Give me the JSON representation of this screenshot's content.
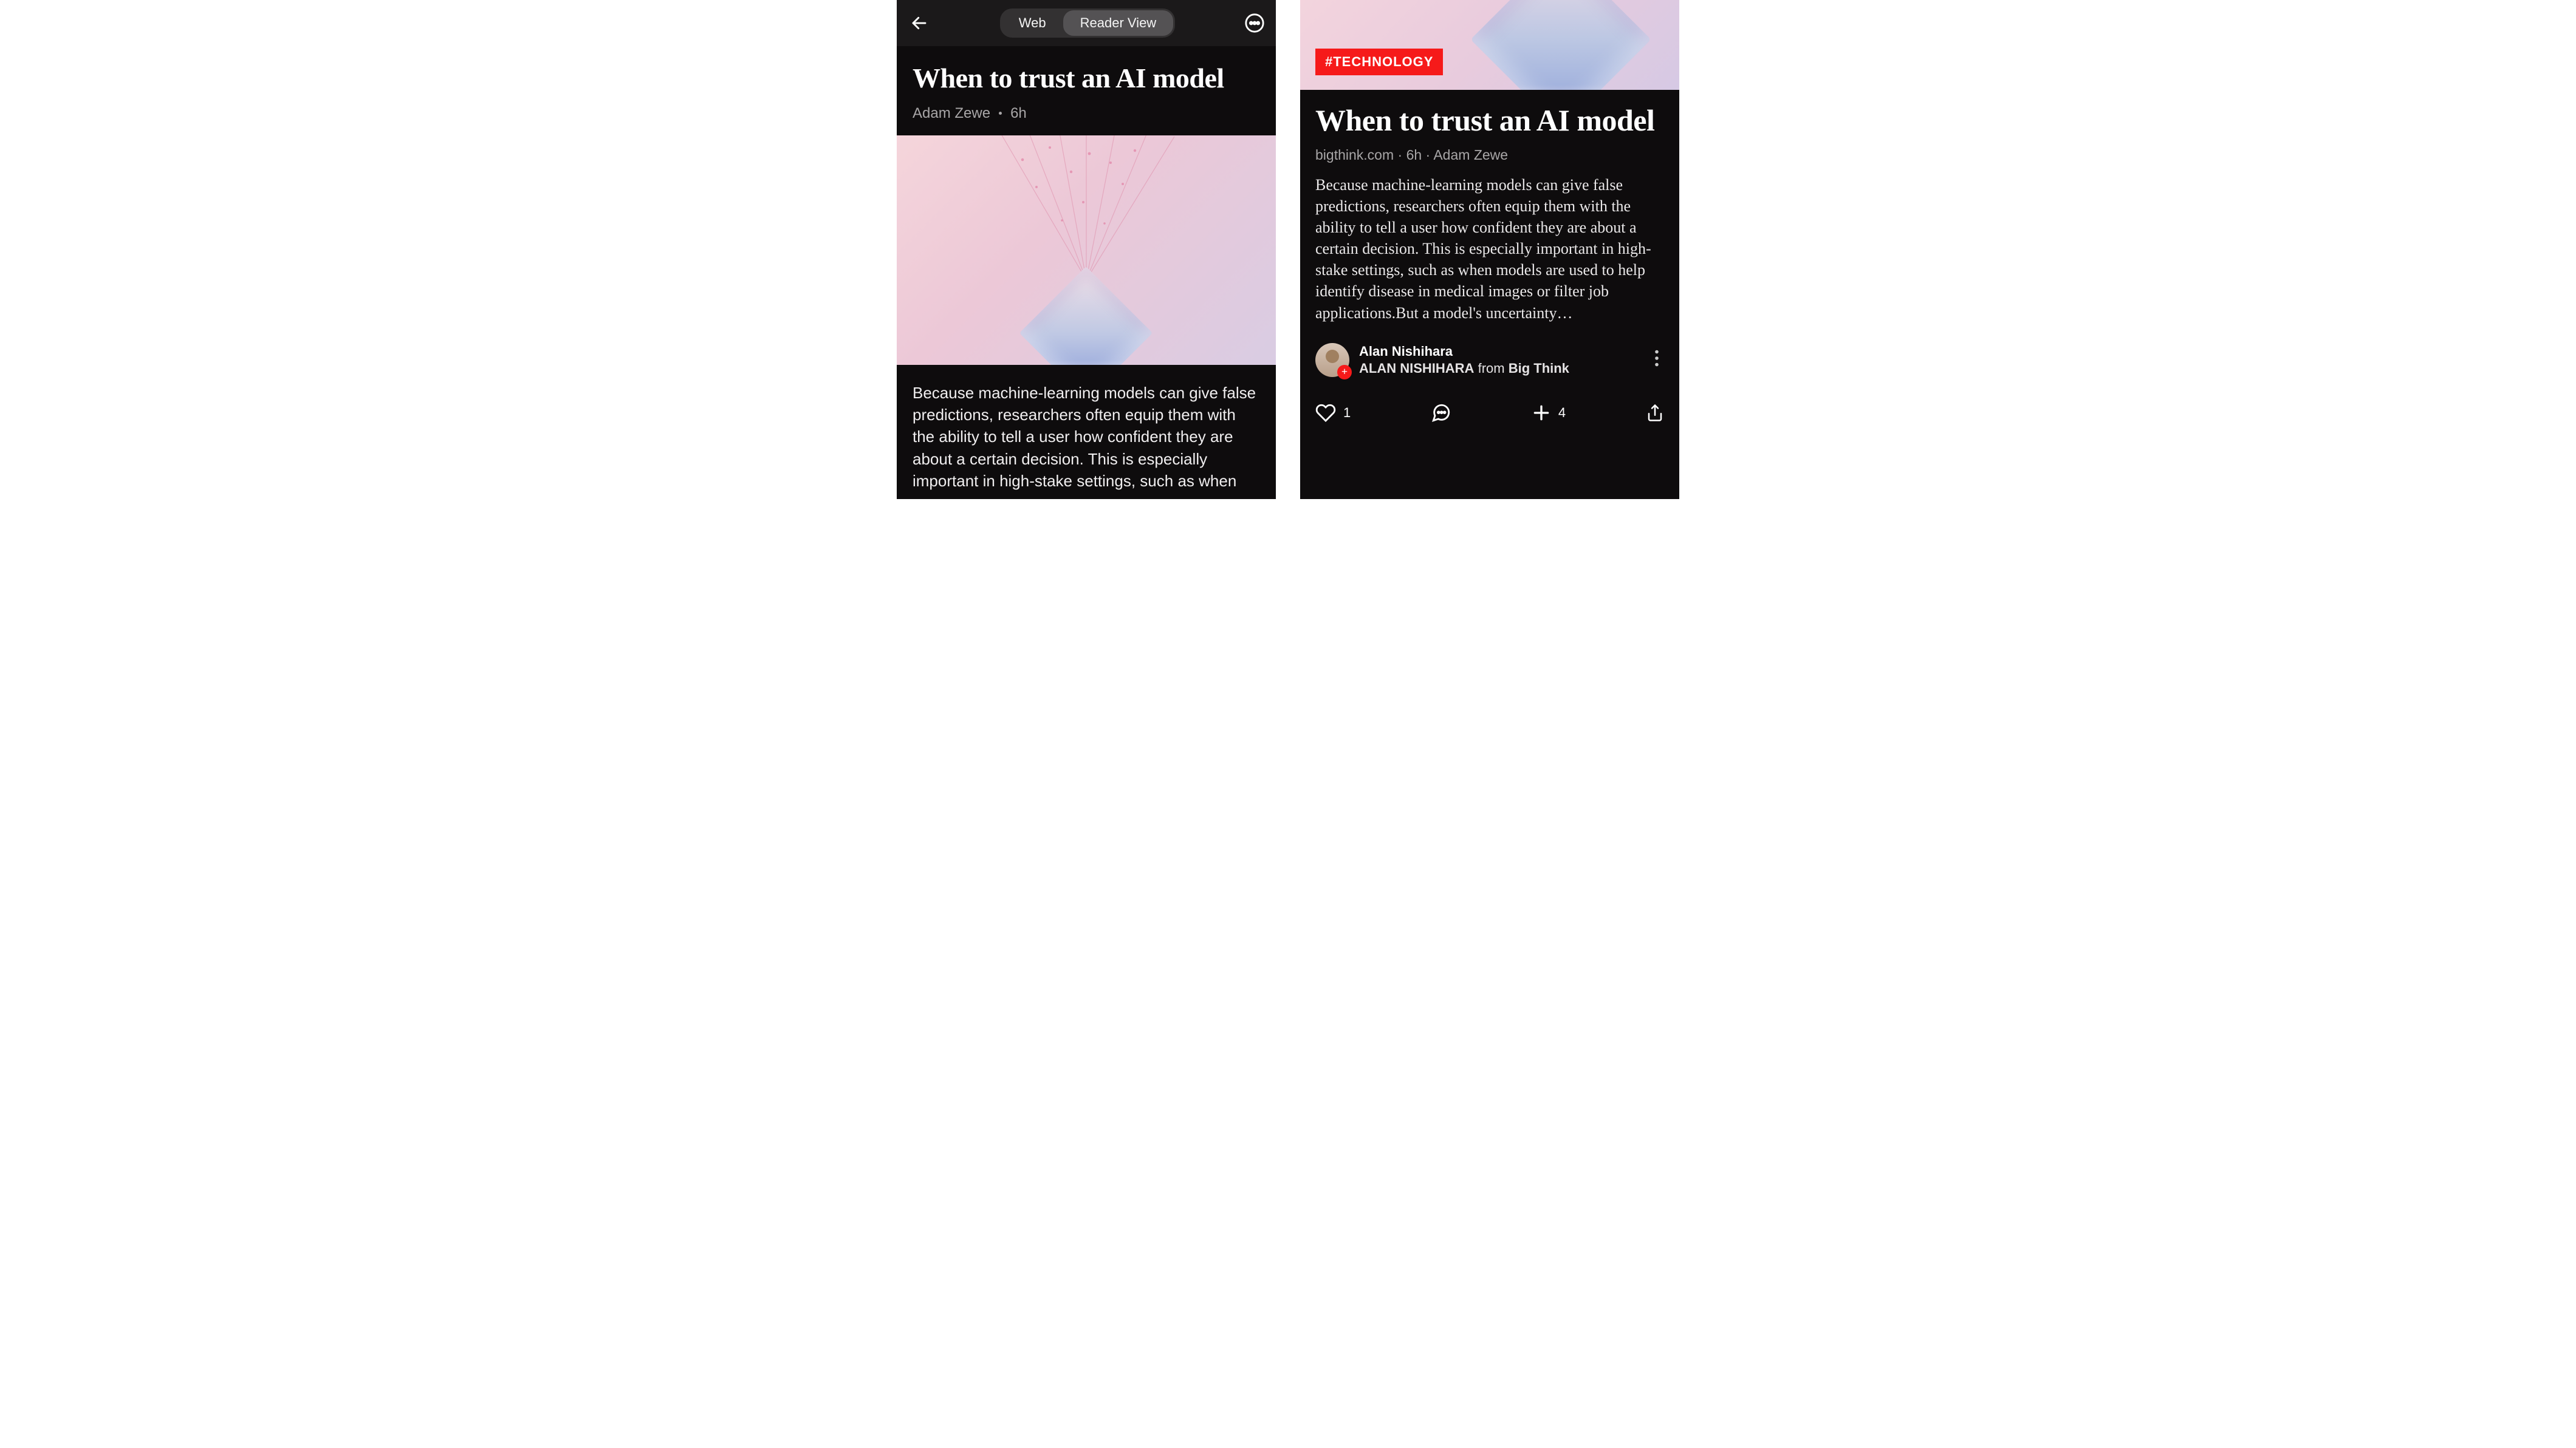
{
  "left": {
    "tabs": {
      "web": "Web",
      "reader": "Reader View",
      "active": "reader"
    },
    "title": "When to trust an AI model",
    "author": "Adam Zewe",
    "time": "6h",
    "body": "Because machine-learning models can give false predictions, researchers often equip them with the ability to tell a user how confident they are about a certain decision. This is especially important in high-stake settings, such as when"
  },
  "right": {
    "tag": "#TECHNOLOGY",
    "title": "When to trust an AI model",
    "source": "bigthink.com",
    "time": "6h",
    "author": "Adam Zewe",
    "excerpt": "Because machine-learning models can give false predictions, researchers often equip them with the ability to tell a user how confident they are about a certain decision. This is especially important in high-stake settings, such as when models are used to help identify disease in medical images or filter job applications.But a model's uncertainty…",
    "curator": {
      "name": "Alan Nishihara",
      "source_caps": "ALAN NISHIHARA",
      "from_word": "from",
      "publication": "Big Think"
    },
    "actions": {
      "likes": "1",
      "plus": "4"
    }
  }
}
